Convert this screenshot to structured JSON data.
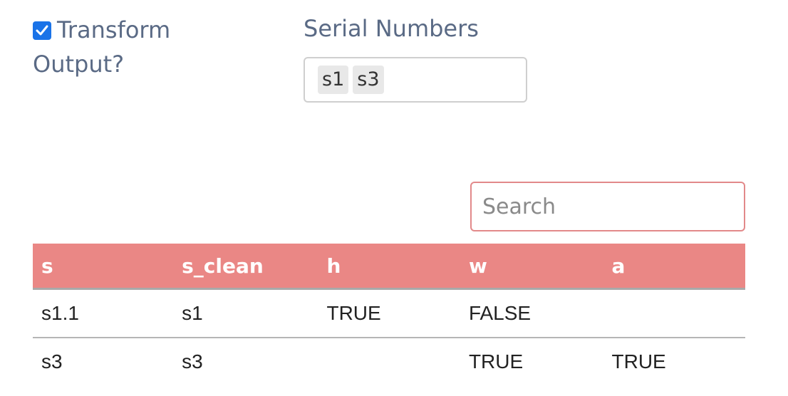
{
  "checkbox": {
    "label": "Transform Output?",
    "checked": true,
    "color": "#1a73e8"
  },
  "select": {
    "label": "Serial Numbers",
    "chips": [
      "s1",
      "s3"
    ]
  },
  "search": {
    "placeholder": "Search",
    "border_color": "#e2898a"
  },
  "table": {
    "header_color": "#ea8785",
    "headers": [
      "s",
      "s_clean",
      "h",
      "w",
      "a"
    ],
    "rows": [
      [
        "s1.1",
        "s1",
        "TRUE",
        "FALSE",
        ""
      ],
      [
        "s3",
        "s3",
        "",
        "TRUE",
        "TRUE"
      ]
    ]
  }
}
